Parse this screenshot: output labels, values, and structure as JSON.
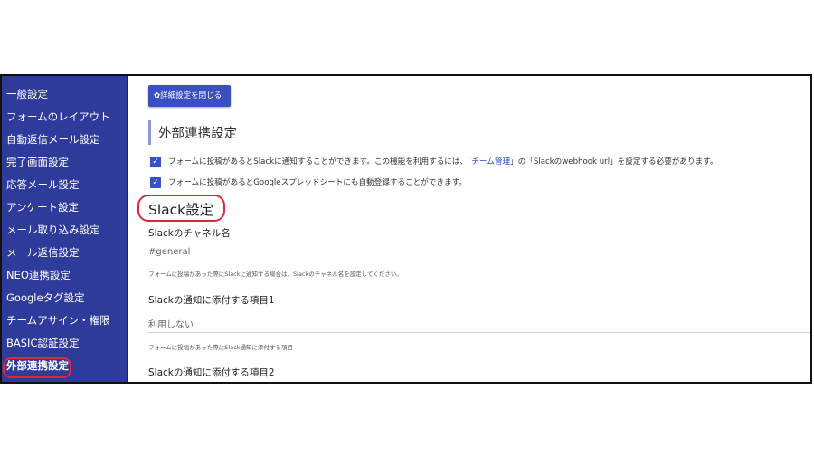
{
  "sidebar": {
    "items": [
      {
        "label": "一般設定"
      },
      {
        "label": "フォームのレイアウト"
      },
      {
        "label": "自動返信メール設定"
      },
      {
        "label": "完了画面設定"
      },
      {
        "label": "応答メール設定"
      },
      {
        "label": "アンケート設定"
      },
      {
        "label": "メール取り込み設定"
      },
      {
        "label": "メール返信設定"
      },
      {
        "label": "NEO連携設定"
      },
      {
        "label": "Googleタグ設定"
      },
      {
        "label": "チームアサイン・権限"
      },
      {
        "label": "BASIC認証設定"
      },
      {
        "label": "外部連携設定",
        "active": true
      }
    ]
  },
  "toolbar": {
    "toggle_icon": "✿",
    "toggle_label": "詳細設定を閉じる"
  },
  "section": {
    "title": "外部連携設定"
  },
  "checks": {
    "slack": {
      "checked": true,
      "text_before": "フォームに投稿があるとSlackに通知することができます。この機能を利用するには、「",
      "link": "チーム管理",
      "text_after": "」の「Slackのwebhook url」を設定する必要があります。"
    },
    "google": {
      "checked": true,
      "text": "フォームに投稿があるとGoogleスプレッドシートにも自動登録することができます。"
    }
  },
  "slack": {
    "heading": "Slack設定",
    "channel": {
      "label": "Slackのチャネル名",
      "value": "#general",
      "help": "フォームに投稿があった際にSlackに通知する場合は、Slackのチャネル名を設定してください。"
    },
    "attach1": {
      "label": "Slackの通知に添付する項目1",
      "value": "利用しない",
      "help": "フォームに投稿があった際にSlack通知に添付する項目"
    },
    "attach2": {
      "label": "Slackの通知に添付する項目2"
    }
  },
  "colors": {
    "sidebar_bg": "#2f3b9b",
    "accent": "#3a4fc2",
    "highlight": "#e0263a",
    "link": "#2a44c8"
  }
}
